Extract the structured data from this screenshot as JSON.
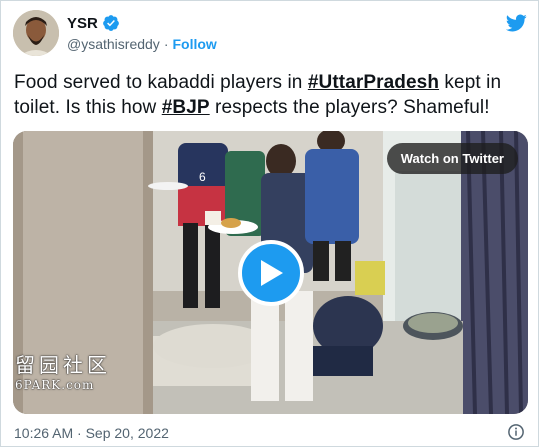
{
  "author": {
    "name": "YSR",
    "handle": "@ysathisreddy",
    "separator": "·",
    "follow_label": "Follow"
  },
  "tweet": {
    "text_part1": "Food served to kabaddi players in ",
    "hashtag1": "#UttarPradesh",
    "text_part2": " kept in toilet. Is this how ",
    "hashtag2": "#BJP",
    "text_part3": " respects the players? Shameful!"
  },
  "media": {
    "watch_label": "Watch on Twitter",
    "watermark_cn": "留园社区",
    "watermark_en": "6PARK.com",
    "jersey_number": "6"
  },
  "footer": {
    "timestamp": "10:26 AM · Sep 20, 2022"
  },
  "colors": {
    "accent": "#1d9bf0",
    "text": "#0f1419",
    "muted": "#536471"
  },
  "icons": {
    "verified": "verified-badge-icon",
    "twitter": "twitter-bird-icon",
    "play": "play-icon",
    "info": "info-icon"
  }
}
